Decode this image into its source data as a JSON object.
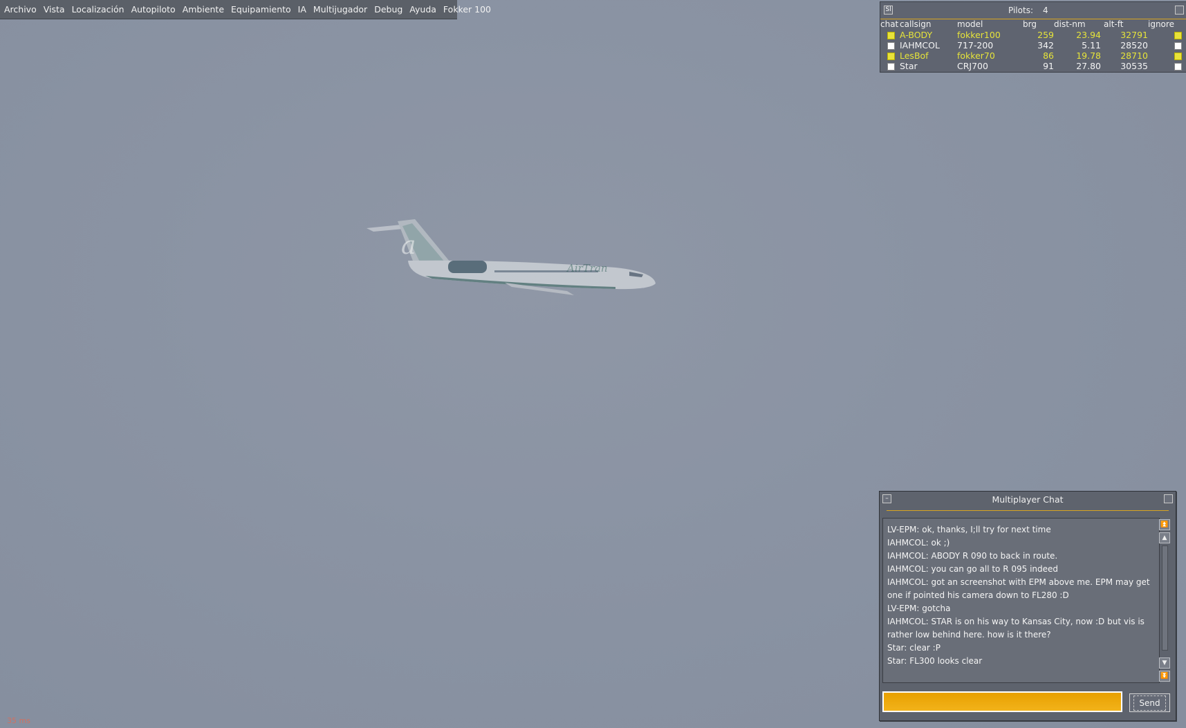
{
  "menu": [
    "Archivo",
    "Vista",
    "Localización",
    "Autopiloto",
    "Ambiente",
    "Equipamiento",
    "IA",
    "Multijugador",
    "Debug",
    "Ayuda",
    "Fokker 100"
  ],
  "pilot_list": {
    "sl_button": "Sl",
    "pilots_label": "Pilots:",
    "pilots_count": "4",
    "columns": [
      "chat",
      "callsign",
      "model",
      "brg",
      "dist-nm",
      "alt-ft",
      "ignore"
    ],
    "rows": [
      {
        "chat": true,
        "callsign": "A-BODY",
        "model": "fokker100",
        "brg": "259",
        "dist": "23.94",
        "alt": "32791",
        "ignore": true,
        "highlight": true
      },
      {
        "chat": false,
        "callsign": "IAHMCOL",
        "model": "717-200",
        "brg": "342",
        "dist": "5.11",
        "alt": "28520",
        "ignore": false,
        "highlight": false
      },
      {
        "chat": true,
        "callsign": "LesBof",
        "model": "fokker70",
        "brg": "86",
        "dist": "19.78",
        "alt": "28710",
        "ignore": true,
        "highlight": true
      },
      {
        "chat": false,
        "callsign": "Star",
        "model": "CRJ700",
        "brg": "91",
        "dist": "27.80",
        "alt": "30535",
        "ignore": false,
        "highlight": false
      }
    ]
  },
  "chat": {
    "title": "Multiplayer Chat",
    "minimize": "–",
    "send_label": "Send",
    "input_value": "",
    "messages": [
      "LV-EPM: ok, thanks, I;ll try for next time",
      "IAHMCOL: ok ;)",
      "IAHMCOL: ABODY R 090 to back in route.",
      "IAHMCOL: you can go all to R 095 indeed",
      "IAHMCOL: got an screenshot with EPM above me. EPM may get",
      "one if pointed his camera down to FL280 :D",
      "LV-EPM: gotcha",
      "IAHMCOL: STAR is on his way to Kansas City, now :D but vis is",
      "rather low behind here. how is it there?",
      "Star: clear :P",
      "Star: FL300 looks clear"
    ]
  },
  "aircraft": {
    "tail_letter": "a",
    "livery_text": "AirTran"
  },
  "status": {
    "fps": "35 ms"
  },
  "colors": {
    "sky": "#8a93a3",
    "highlight_text": "#e6e43a",
    "accent_rule": "#d9a520",
    "chat_input": "#f2b31a"
  }
}
